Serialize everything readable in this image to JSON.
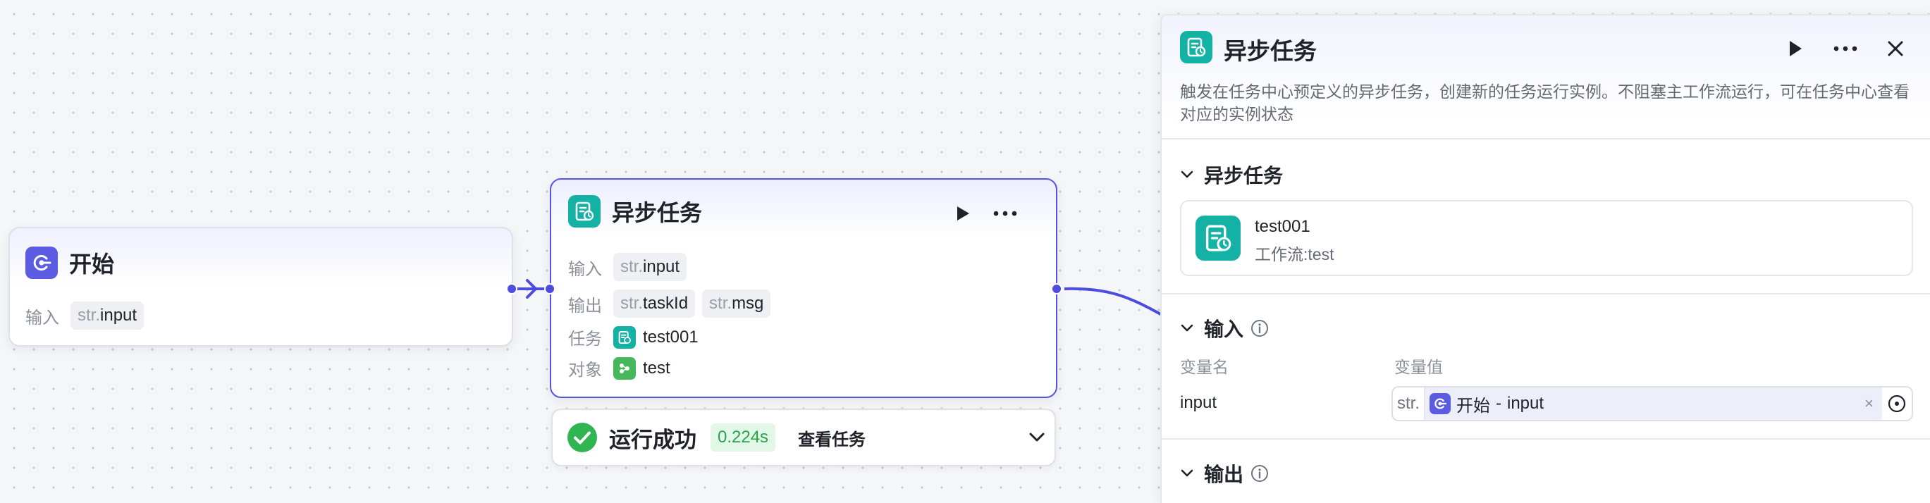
{
  "nodes": {
    "start": {
      "title": "开始",
      "input_label": "输入",
      "input_type": "str.",
      "input_var": "input"
    },
    "task": {
      "title": "异步任务",
      "input_label": "输入",
      "input_type": "str.",
      "input_var": "input",
      "output_label": "输出",
      "outputs": [
        {
          "type": "str.",
          "name": "taskId"
        },
        {
          "type": "str.",
          "name": "msg"
        }
      ],
      "task_label": "任务",
      "task_value": "test001",
      "object_label": "对象",
      "object_value": "test"
    }
  },
  "run_result": {
    "status": "运行成功",
    "duration": "0.224s",
    "view_link": "查看任务"
  },
  "panel": {
    "title": "异步任务",
    "description": "触发在任务中心预定义的异步任务，创建新的任务运行实例。不阻塞主工作流运行，可在任务中心查看对应的实例状态",
    "section_task": "异步任务",
    "task_card": {
      "name": "test001",
      "workflow": "工作流:test"
    },
    "section_input": "输入",
    "col_var_name": "变量名",
    "col_var_value": "变量值",
    "input_row": {
      "name": "input",
      "type": "str.",
      "ref_node": "开始",
      "ref_separator": "-",
      "ref_var": "input",
      "clear": "×"
    },
    "section_output": "输出"
  },
  "colors": {
    "accent": "#4c4cde",
    "teal": "#14b1a5",
    "success": "#2fb552",
    "object_green": "#45b85c"
  },
  "icons": {
    "start": "start-node-icon",
    "task": "async-task-icon",
    "run": "play-icon",
    "more": "more-icon",
    "close": "close-icon",
    "success": "check-circle-icon",
    "expand": "chevron-down-icon",
    "info": "info-icon",
    "picker": "variable-picker-icon"
  }
}
